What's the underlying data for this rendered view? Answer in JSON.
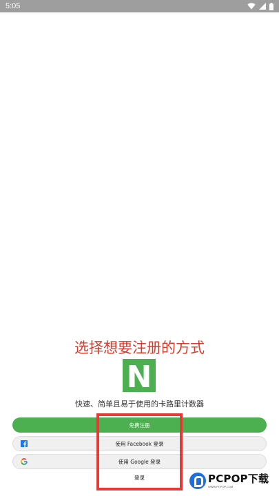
{
  "status_bar": {
    "time": "5:05",
    "icons": [
      "wifi-icon",
      "signal-icon",
      "battery-icon"
    ]
  },
  "register": {
    "headline": "选择想要注册的方式",
    "logo_letter": "N",
    "tagline": "快速、简单且易于使用的卡路里计数器",
    "buttons": {
      "free_signup": "免费注册",
      "facebook": "使用 Facebook 登录",
      "google": "使用 Google 登录"
    },
    "login_link": "登录"
  },
  "watermark": {
    "brand": "PCPOP下载",
    "sub": "WWW.PCPOP.COM"
  },
  "colors": {
    "accent_green": "#4caf50",
    "headline_red": "#d83a2b",
    "highlight_red": "#e53935",
    "facebook_blue": "#1877f2"
  }
}
